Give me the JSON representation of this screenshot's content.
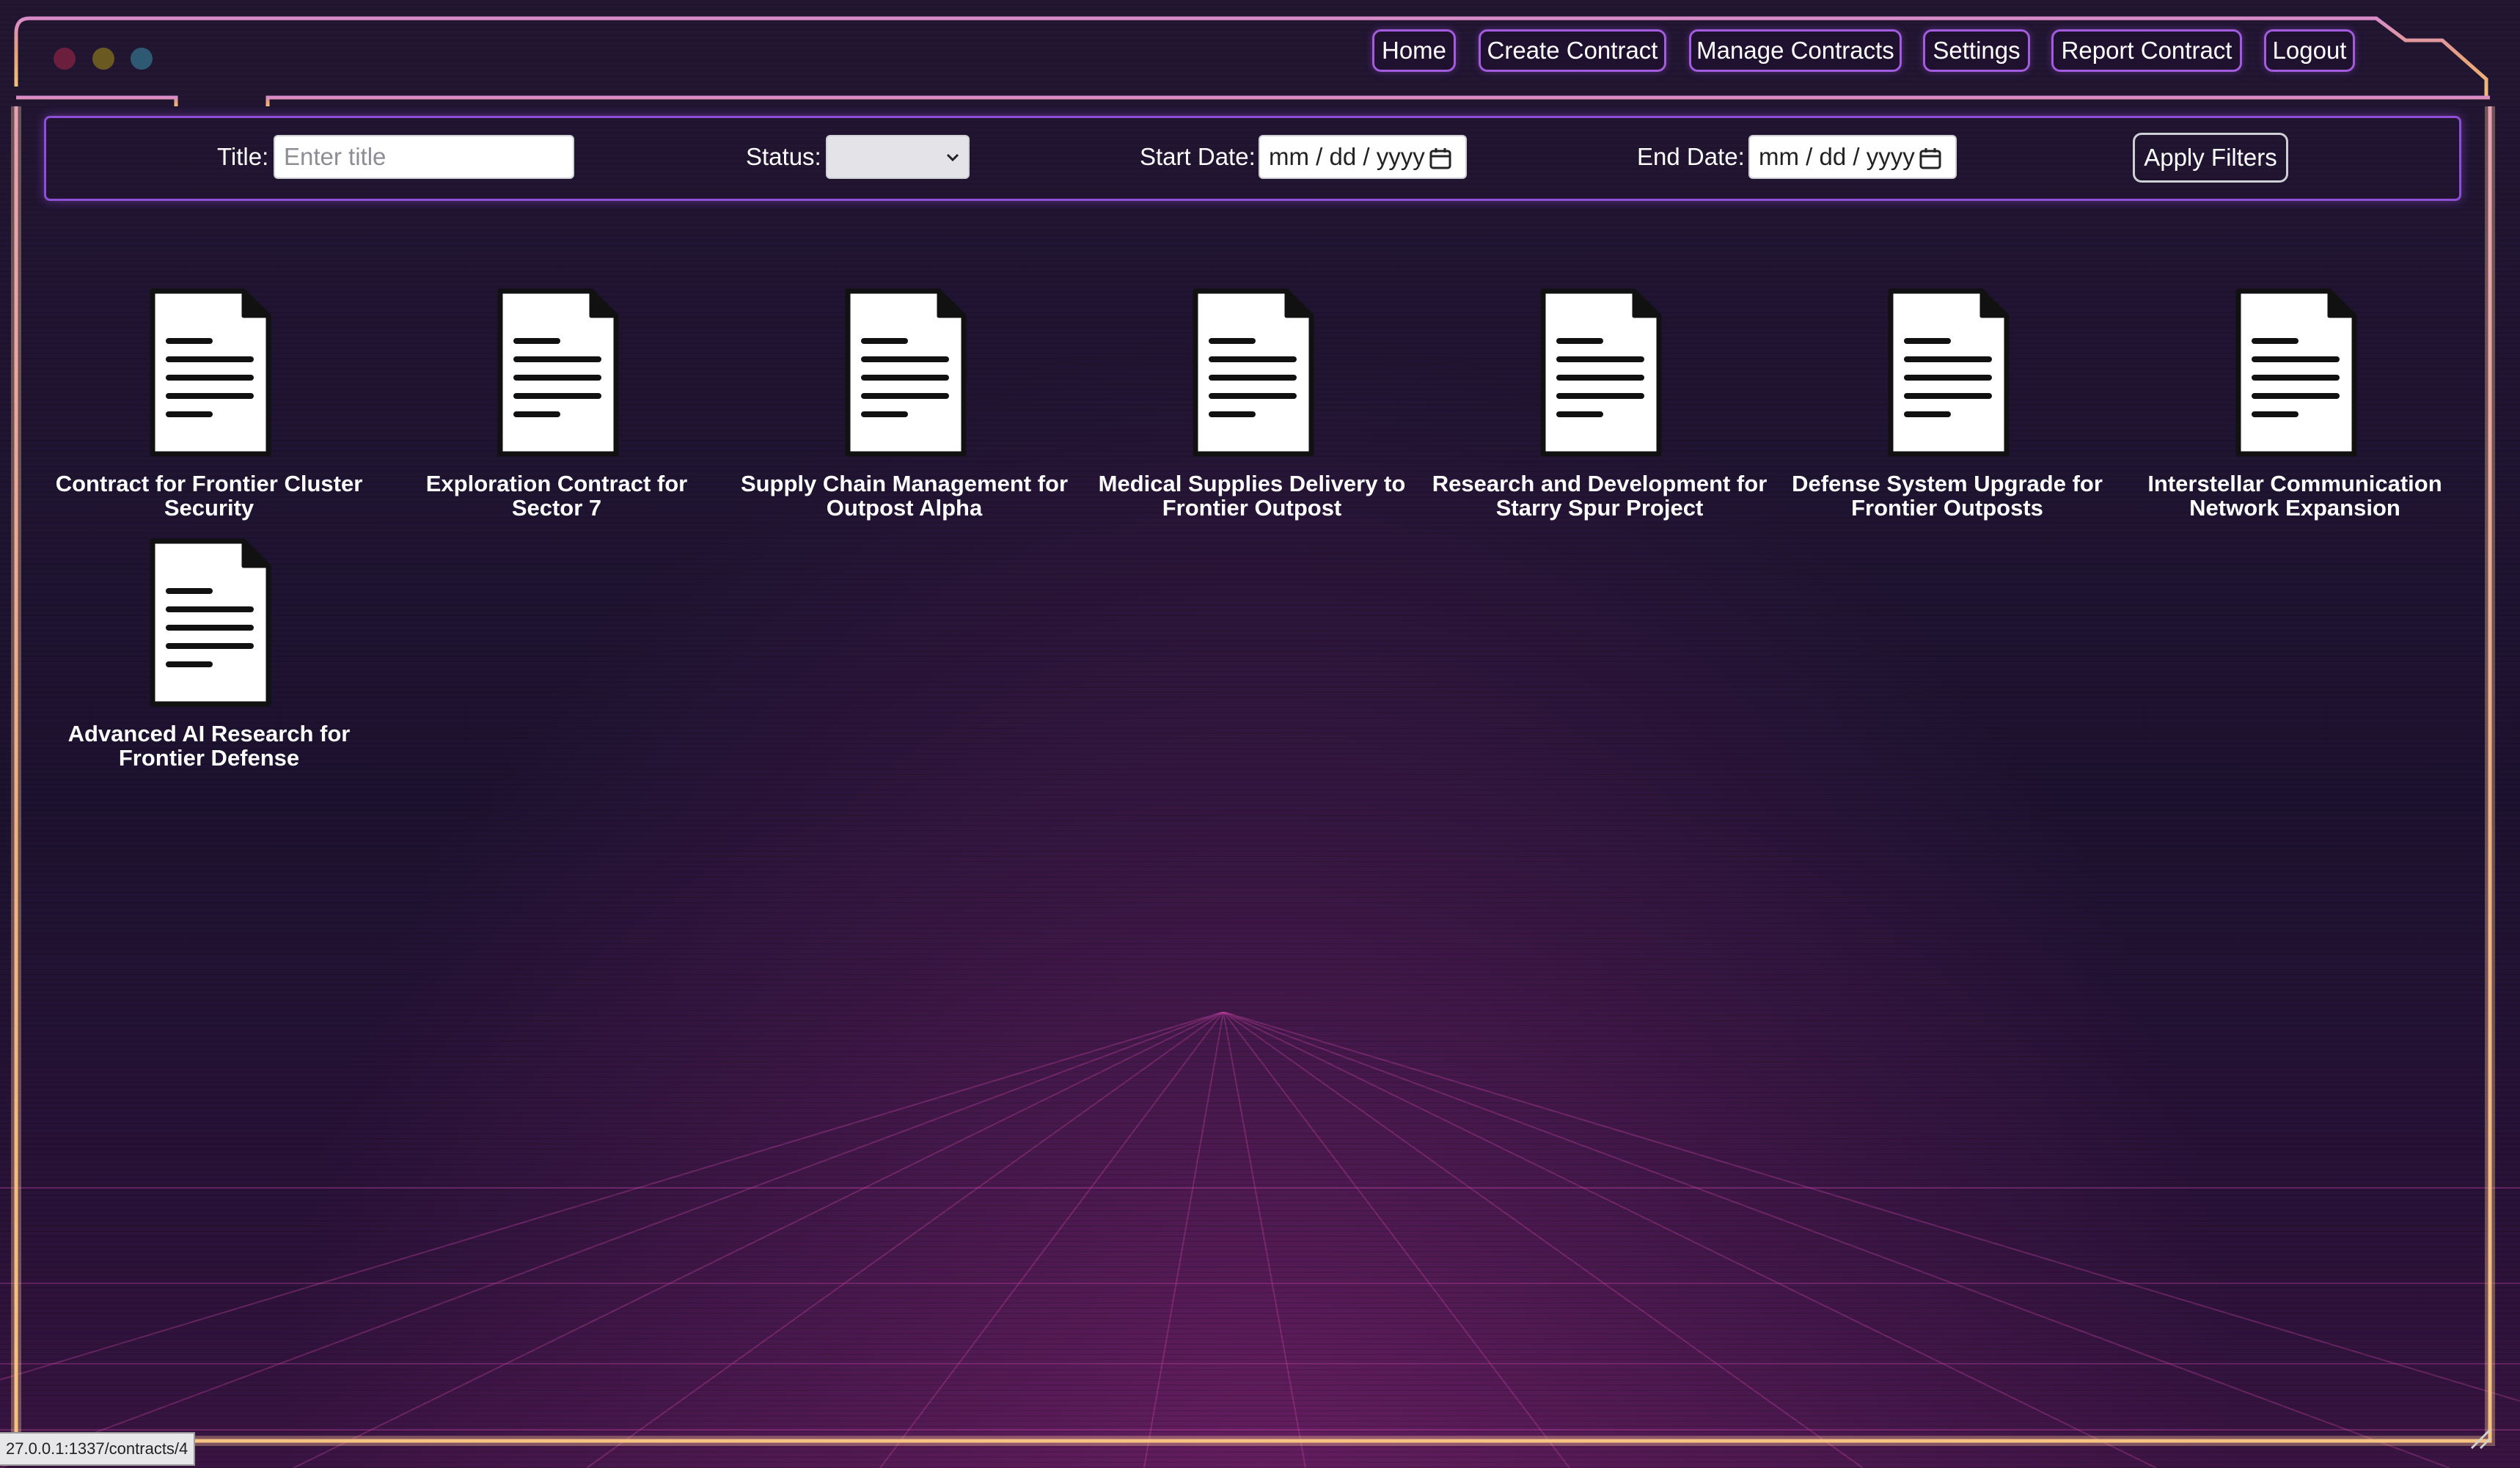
{
  "window": {
    "traffic_lights": [
      {
        "name": "close",
        "color": "#6b1f3c"
      },
      {
        "name": "minimize",
        "color": "#6a5a22"
      },
      {
        "name": "maximize",
        "color": "#2d5a72"
      }
    ]
  },
  "nav": {
    "home": "Home",
    "create_contract": "Create Contract",
    "manage_contracts": "Manage Contracts",
    "settings": "Settings",
    "report_contract": "Report Contract",
    "logout": "Logout"
  },
  "filters": {
    "title_label": "Title:",
    "title_placeholder": "Enter title",
    "status_label": "Status:",
    "status_value": "",
    "start_date_label": "Start Date:",
    "start_date_placeholder": "mm / dd / yyyy",
    "end_date_label": "End Date:",
    "end_date_placeholder": "mm / dd / yyyy",
    "apply_label": "Apply Filters"
  },
  "contracts": [
    {
      "title": "Contract for Frontier Cluster Security",
      "icon": "document-icon"
    },
    {
      "title": "Exploration Contract for Sector 7",
      "icon": "document-icon"
    },
    {
      "title": "Supply Chain Management for Outpost Alpha",
      "icon": "document-icon"
    },
    {
      "title": "Medical Supplies Delivery to Frontier Outpost",
      "icon": "document-icon"
    },
    {
      "title": "Research and Development for Starry Spur Project",
      "icon": "document-icon"
    },
    {
      "title": "Defense System Upgrade for Frontier Outposts",
      "icon": "document-icon"
    },
    {
      "title": "Interstellar Communication Network Expansion",
      "icon": "document-icon"
    },
    {
      "title": "Advanced AI Research for Frontier Defense",
      "icon": "document-icon"
    }
  ],
  "status_bar": {
    "url": "27.0.0.1:1337/contracts/4"
  },
  "colors": {
    "accent": "#a35be0",
    "frame_glow": "#f0b070",
    "background": "#1d1230"
  }
}
